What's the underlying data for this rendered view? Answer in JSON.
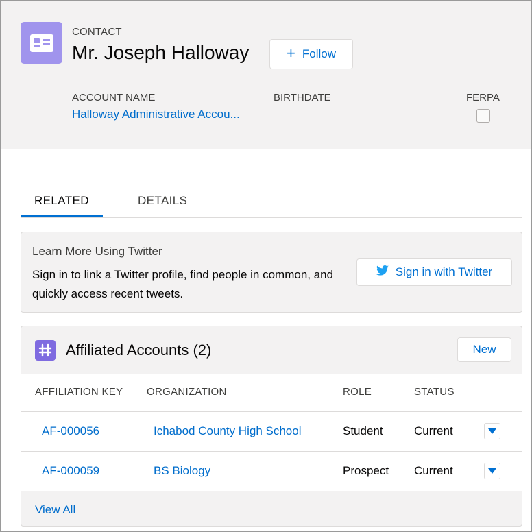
{
  "header": {
    "record_type": "CONTACT",
    "record_name": "Mr. Joseph Halloway",
    "follow_label": "Follow",
    "fields": {
      "account_name_label": "ACCOUNT NAME",
      "account_name_value": "Halloway Administrative Accou...",
      "birthdate_label": "BIRTHDATE",
      "ferpa_label": "FERPA",
      "ferpa_checked": false
    }
  },
  "tabs": [
    {
      "label": "RELATED",
      "active": true
    },
    {
      "label": "DETAILS",
      "active": false
    }
  ],
  "twitter": {
    "title": "Learn More Using Twitter",
    "description": "Sign in to link a Twitter profile, find people in common, and quickly access recent tweets.",
    "button_label": "Sign in with Twitter"
  },
  "affiliated": {
    "title": "Affiliated Accounts (2)",
    "new_label": "New",
    "columns": [
      "AFFILIATION KEY",
      "ORGANIZATION",
      "ROLE",
      "STATUS"
    ],
    "rows": [
      {
        "key": "AF-000056",
        "organization": "Ichabod County High School",
        "role": "Student",
        "status": "Current"
      },
      {
        "key": "AF-000059",
        "organization": "BS Biology",
        "role": "Prospect",
        "status": "Current"
      }
    ],
    "view_all_label": "View All"
  },
  "colors": {
    "accent": "#0070d2",
    "contact_icon": "#a094ed",
    "affiliation_icon": "#7f6be0",
    "header_bg": "#f3f2f2"
  },
  "icons": {
    "contact": "contact-card-icon",
    "follow": "plus-icon",
    "twitter": "twitter-bird-icon",
    "affiliation": "hashtag-icon",
    "row_menu": "caret-down-icon"
  }
}
